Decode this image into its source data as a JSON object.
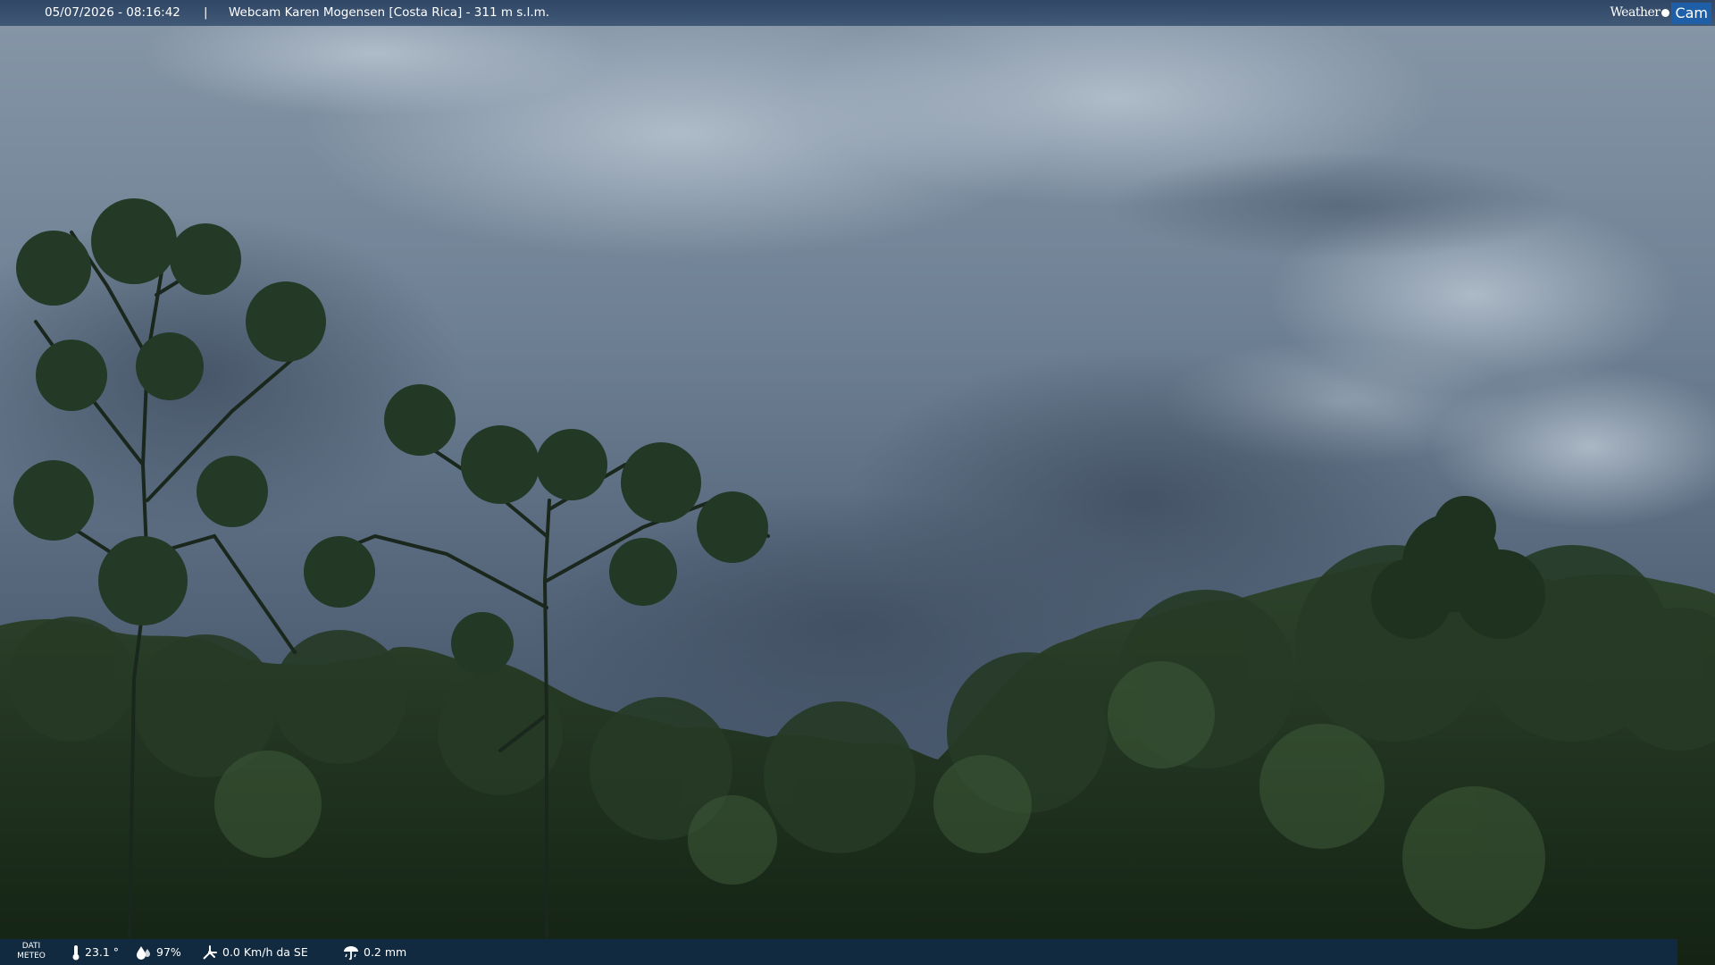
{
  "header": {
    "datetime": "05/07/2026 - 08:16:42",
    "separator": "|",
    "title": "Webcam Karen Mogensen [Costa Rica] - 311 m s.l.m."
  },
  "logo": {
    "left_text": "Weather",
    "right_text": "Cam",
    "accent_color": "#1e5fa8"
  },
  "weather": {
    "label_line1": "DATI",
    "label_line2": "METEO",
    "temperature": "23.1 °",
    "humidity": "97%",
    "wind": "0.0 Km/h da SE",
    "rain": "0.2 mm",
    "icons": [
      "thermometer-icon",
      "humidity-drop-icon",
      "wind-icon",
      "rain-gauge-icon"
    ]
  },
  "colors": {
    "sky": "#6f8194",
    "foliage": "#1d2f1d",
    "bar": "#16304c"
  }
}
